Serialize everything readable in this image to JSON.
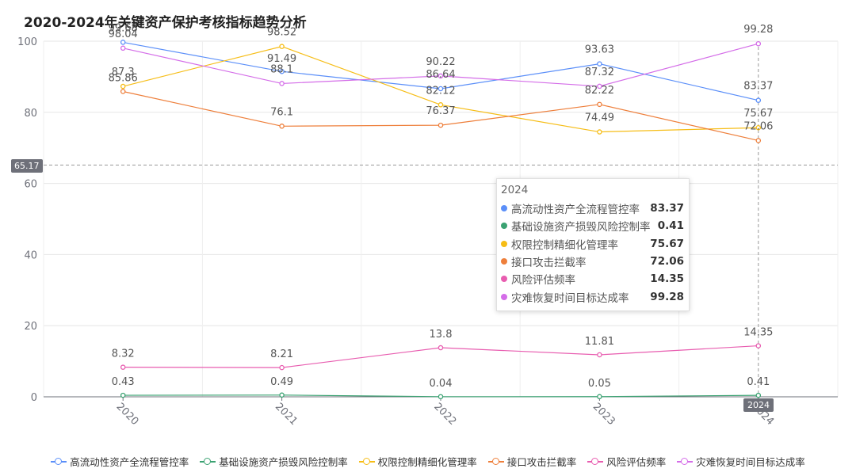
{
  "chart_data": {
    "type": "line",
    "title": "2020-2024年关键资产保护考核指标趋势分析",
    "categories": [
      "2020",
      "2021",
      "2022",
      "2023",
      "2024"
    ],
    "ylim": [
      0,
      100
    ],
    "y_ticks": [
      "0",
      "20",
      "40",
      "60",
      "80",
      "100"
    ],
    "grid": true,
    "legend_position": "bottom",
    "series": [
      {
        "name": "高流动性资产全流程管控率",
        "color": "#5b8ff9",
        "values": [
          99.68,
          91.49,
          86.64,
          93.63,
          83.37
        ]
      },
      {
        "name": "基础设施资产损毁风险控制率",
        "color": "#3ba272",
        "values": [
          0.43,
          0.49,
          0.04,
          0.05,
          0.41
        ]
      },
      {
        "name": "权限控制精细化管理率",
        "color": "#f6bd16",
        "values": [
          87.3,
          98.52,
          82.12,
          74.49,
          75.67
        ]
      },
      {
        "name": "接口攻击拦截率",
        "color": "#ee7f3b",
        "values": [
          85.86,
          76.1,
          76.37,
          82.22,
          72.06
        ]
      },
      {
        "name": "风险评估频率",
        "color": "#e85db0",
        "values": [
          8.32,
          8.21,
          13.8,
          11.81,
          14.35
        ]
      },
      {
        "name": "灾难恢复时间目标达成率",
        "color": "#d46de8",
        "values": [
          98.04,
          88.1,
          90.22,
          87.32,
          99.28
        ]
      }
    ]
  },
  "tooltip": {
    "title": "2024",
    "rows": [
      {
        "name": "高流动性资产全流程管控率",
        "value": "83.37",
        "color": "#5b8ff9"
      },
      {
        "name": "基础设施资产损毁风险控制率",
        "value": "0.41",
        "color": "#3ba272"
      },
      {
        "name": "权限控制精细化管理率",
        "value": "75.67",
        "color": "#f6bd16"
      },
      {
        "name": "接口攻击拦截率",
        "value": "72.06",
        "color": "#ee7f3b"
      },
      {
        "name": "风险评估频率",
        "value": "14.35",
        "color": "#e85db0"
      },
      {
        "name": "灾难恢复时间目标达成率",
        "value": "99.28",
        "color": "#d46de8"
      }
    ]
  },
  "crosshair": {
    "y_value": "65.17",
    "x_value": "2024"
  }
}
